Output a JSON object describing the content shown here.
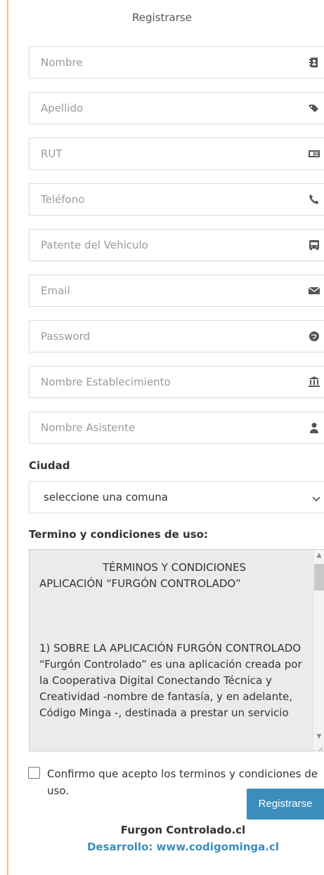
{
  "form": {
    "title": "Registrarse",
    "fields": [
      {
        "placeholder": "Nombre",
        "icon": "contact-book-icon"
      },
      {
        "placeholder": "Apellido",
        "icon": "tags-icon"
      },
      {
        "placeholder": "RUT",
        "icon": "id-card-icon"
      },
      {
        "placeholder": "Teléfono",
        "icon": "phone-icon"
      },
      {
        "placeholder": "Patente del Vehiculo",
        "icon": "bus-icon"
      },
      {
        "placeholder": "Email",
        "icon": "envelope-icon"
      },
      {
        "placeholder": "Password",
        "icon": "key-globe-icon"
      },
      {
        "placeholder": "Nombre Establecimiento",
        "icon": "institution-icon"
      },
      {
        "placeholder": "Nombre Asistente",
        "icon": "user-icon"
      }
    ],
    "city_label": "Ciudad",
    "city_select_value": "seleccione una comuna",
    "terms_label": "Termino y condiciones de uso:",
    "terms_text": {
      "heading1": "TÉRMINOS Y CONDICIONES",
      "heading2": "APLICACIÓN “FURGÓN CONTROLADO”",
      "section1_title": "1) SOBRE LA APLICACIÓN FURGÓN CONTROLADO",
      "section1_body": "“Furgón Controlado” es una aplicación creada por la Cooperativa Digital Conectando Técnica y Creatividad -nombre de fantasía, y en adelante, Código Minga -, destinada a prestar un servicio"
    },
    "accept_label": "Confirmo que acepto los terminos y condiciones de uso.",
    "submit_label": "Registrarse"
  },
  "footer": {
    "brand": "Furgon Controlado.cl",
    "developer": "Desarrollo: www.codigominga.cl"
  },
  "colors": {
    "accent": "#3c8dbc",
    "rule": "#f2c94c"
  }
}
